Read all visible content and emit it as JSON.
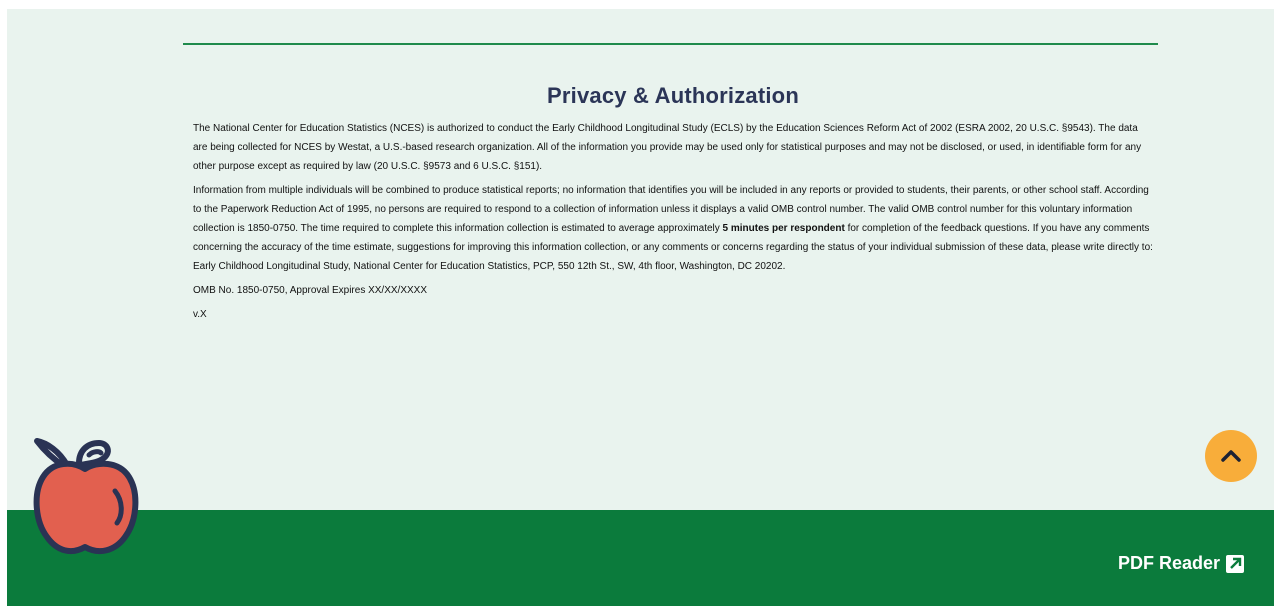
{
  "privacy": {
    "title": "Privacy & Authorization",
    "paragraph_1": "The National Center for Education Statistics (NCES) is authorized to conduct the Early Childhood Longitudinal Study (ECLS) by the Education Sciences Reform Act of 2002 (ESRA 2002, 20 U.S.C. §9543). The data are being collected for NCES by Westat, a U.S.-based research organization. All of the information you provide may be used only for statistical purposes and may not be disclosed, or used, in identifiable form for any other purpose except as required by law (20 U.S.C. §9573 and 6 U.S.C. §151).",
    "paragraph_2_before": "Information from multiple individuals will be combined to produce statistical reports; no information that identifies you will be included in any reports or provided to students, their parents, or other school staff. According to the Paperwork Reduction Act of 1995, no persons are required to respond to a collection of information unless it displays a valid OMB control number. The valid OMB control number for this voluntary information collection is 1850-0750. The time required to complete this information collection is estimated to average approximately ",
    "paragraph_2_bold": "5 minutes per respondent",
    "paragraph_2_after": " for completion of the feedback questions. If you have any comments concerning the accuracy of the time estimate, suggestions for improving this information collection, or any comments or concerns regarding the status of your individual submission of these data, please write directly to: Early Childhood Longitudinal Study, National Center for Education Statistics, PCP, 550 12th St., SW, 4th floor, Washington, DC 20202.",
    "omb": "OMB No. 1850-0750, Approval Expires XX/XX/XXXX",
    "version": "v.X"
  },
  "footer": {
    "pdf_reader_label": "PDF Reader"
  },
  "icons": {
    "scroll_top": "chevron-up-icon",
    "external_link": "external-link-icon",
    "apple": "apple-icon"
  },
  "colors": {
    "background": "#e9f3ee",
    "footer_green": "#0b7b3c",
    "rule_green": "#1f8a4c",
    "title_navy": "#2b3557",
    "scroll_button": "#f8ad3a",
    "apple_red": "#e2604f",
    "apple_outline": "#2a3354"
  }
}
